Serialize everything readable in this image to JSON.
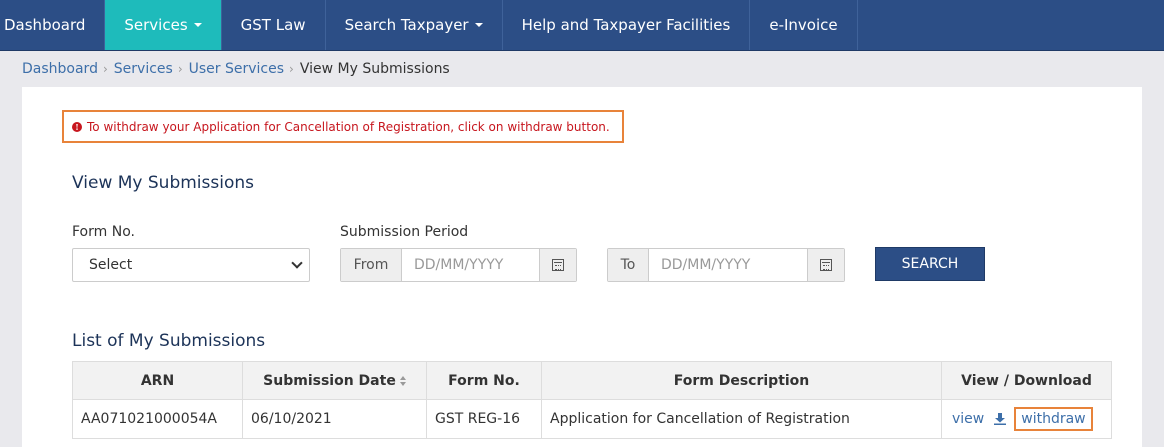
{
  "nav": {
    "items": [
      {
        "label": "Dashboard"
      },
      {
        "label": "Services"
      },
      {
        "label": "GST Law"
      },
      {
        "label": "Search Taxpayer"
      },
      {
        "label": "Help and Taxpayer Facilities"
      },
      {
        "label": "e-Invoice"
      }
    ]
  },
  "breadcrumb": {
    "items": [
      "Dashboard",
      "Services",
      "User Services"
    ],
    "current": "View My Submissions"
  },
  "alert": {
    "text": "To withdraw your Application for Cancellation of Registration, click on withdraw button."
  },
  "form": {
    "title": "View My Submissions",
    "form_no_label": "Form No.",
    "form_no_value": "Select",
    "period_label": "Submission Period",
    "from_label": "From",
    "from_placeholder": "DD/MM/YYYY",
    "to_label": "To",
    "to_placeholder": "DD/MM/YYYY",
    "search_label": "SEARCH"
  },
  "table": {
    "title": "List of My Submissions",
    "headers": [
      "ARN",
      "Submission Date",
      "Form No.",
      "Form Description",
      "View / Download"
    ],
    "rows": [
      {
        "arn": "AA071021000054A",
        "date": "06/10/2021",
        "form_no": "GST REG-16",
        "description": "Application for Cancellation of Registration",
        "view": "view",
        "withdraw": "withdraw"
      }
    ]
  },
  "colors": {
    "nav_bg": "#2c4e86",
    "nav_active": "#1ebbbb",
    "highlight_border": "#e8833a",
    "alert_text": "#c7161e",
    "link": "#3d6fa9"
  }
}
